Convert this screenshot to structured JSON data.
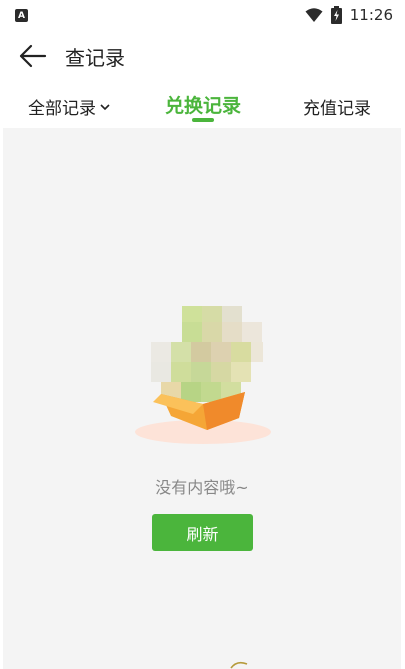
{
  "status_bar": {
    "left_icon": "A",
    "time": "11:26",
    "icons": [
      "wifi-icon",
      "battery-charging-icon"
    ]
  },
  "header": {
    "title": "查记录",
    "back_icon": "arrow-left-icon"
  },
  "tabs": [
    {
      "label": "全部记录",
      "has_dropdown": true,
      "active": false
    },
    {
      "label": "兑换记录",
      "active": true
    },
    {
      "label": "充值记录",
      "active": false
    }
  ],
  "empty_state": {
    "message": "没有内容哦~",
    "button_label": "刷新"
  },
  "colors": {
    "accent": "#4bb53c",
    "content_bg": "#f4f4f4",
    "box_orange": "#f5a636"
  }
}
